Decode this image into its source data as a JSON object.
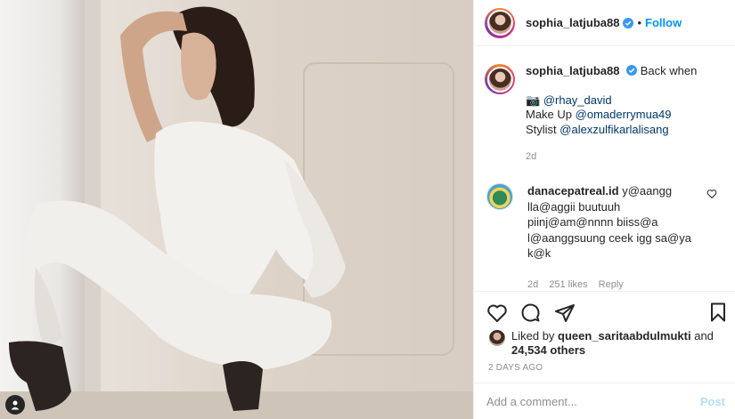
{
  "header": {
    "username": "sophia_latjuba88",
    "separator": "•",
    "follow_label": "Follow"
  },
  "caption": {
    "username": "sophia_latjuba88",
    "text": "Back when",
    "camera": "📷",
    "photo_credit": "@rhay_david",
    "makeup_label": "Make Up",
    "makeup_handle": "@omaderrymua49",
    "stylist_label": "Stylist",
    "stylist_handle": "@alexzulfikarlalisang",
    "time": "2d"
  },
  "comment": {
    "username": "danacepatreal.id",
    "text": "y@aangg lla@aggii buutuuh piinj@am@nnnn biiss@a l@aanggsuung ceek igg sa@ya k@k",
    "time": "2d",
    "likes": "251 likes",
    "reply": "Reply"
  },
  "likes": {
    "prefix": "Liked by",
    "user": "queen_saritaabdulmukti",
    "and": "and",
    "others": "24,534 others"
  },
  "posted_ago": "2 DAYS AGO",
  "add_comment": {
    "placeholder": "Add a comment...",
    "post_label": "Post"
  },
  "colors": {
    "accent": "#0095f6",
    "link": "#00376b",
    "muted": "#8e8e8e",
    "post_disabled": "#b2dffc"
  }
}
